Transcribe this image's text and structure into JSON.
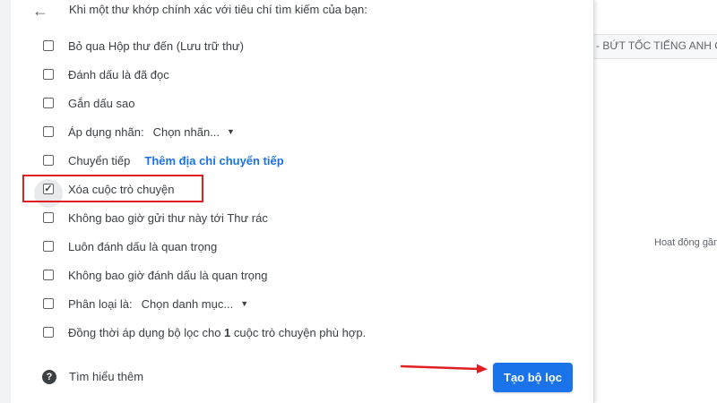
{
  "header": {
    "back_icon": "arrow-left-icon",
    "text": "Khi một thư khớp chính xác với tiêu chí tìm kiếm của bạn:"
  },
  "options": [
    {
      "label": "Bỏ qua Hộp thư đến (Lưu trữ thư)",
      "checked": false
    },
    {
      "label": "Đánh dấu là đã đọc",
      "checked": false
    },
    {
      "label": "Gắn dấu sao",
      "checked": false
    },
    {
      "label": "Áp dụng nhãn:",
      "checked": false,
      "select_value": "Chọn nhãn..."
    },
    {
      "label": "Chuyển tiếp",
      "checked": false,
      "link": "Thêm địa chỉ chuyển tiếp"
    },
    {
      "label": "Xóa cuộc trò chuyện",
      "checked": true
    },
    {
      "label": "Không bao giờ gửi thư này tới Thư rác",
      "checked": false
    },
    {
      "label": "Luôn đánh dấu là quan trọng",
      "checked": false
    },
    {
      "label": "Không bao giờ đánh dấu là quan trọng",
      "checked": false
    },
    {
      "label": "Phân loại là:",
      "checked": false,
      "select_value": "Chọn danh mục..."
    },
    {
      "label_prefix": "Đồng thời áp dụng bộ lọc cho ",
      "label_count": "1",
      "label_suffix": " cuộc trò chuyện phù hợp.",
      "checked": false
    }
  ],
  "footer": {
    "help_icon": "question-circle-icon",
    "help_text": "Tìm hiểu thêm",
    "create_button": "Tạo bộ lọc"
  },
  "background": {
    "subject": "- BỨT TỐC TIẾNG ANH C",
    "activity": "Hoạt động gần"
  },
  "colors": {
    "primary_button": "#1a73e8",
    "highlight": "#e02020",
    "link": "#1a73e8"
  }
}
